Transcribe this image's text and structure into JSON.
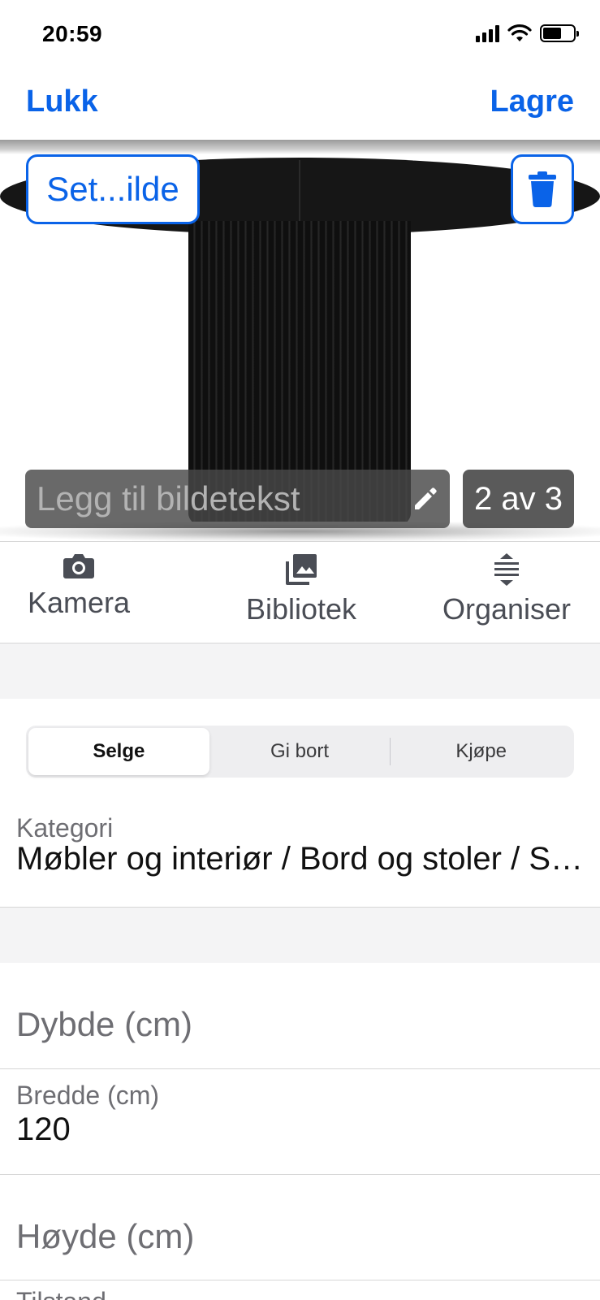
{
  "status_bar": {
    "time": "20:59",
    "icons": [
      "signal-icon",
      "wifi-icon",
      "battery-charging-icon"
    ]
  },
  "nav": {
    "close_label": "Lukk",
    "save_label": "Lagre"
  },
  "photo": {
    "cover_label": "Set...ilde",
    "delete_icon": "trash-icon",
    "caption_placeholder": "Legg til bildetekst",
    "edit_icon": "pencil-icon",
    "counter": "2 av 3"
  },
  "toolbar": {
    "camera_label": "Kamera",
    "library_label": "Bibliotek",
    "organise_label": "Organiser"
  },
  "listing_type": {
    "options": [
      "Selge",
      "Gi bort",
      "Kjøpe"
    ],
    "selected": "Selge"
  },
  "category": {
    "label": "Kategori",
    "value": "Møbler og interiør / Bord og stoler / Spisebord"
  },
  "dimensions": {
    "depth_placeholder": "Dybde (cm)",
    "width_label": "Bredde (cm)",
    "width_value": "120",
    "height_placeholder": "Høyde (cm)",
    "next_field_label": "Tilstand"
  },
  "colors": {
    "accent": "#0a63e8",
    "separator": "#d6d6d6",
    "section_background": "#f4f4f5"
  }
}
